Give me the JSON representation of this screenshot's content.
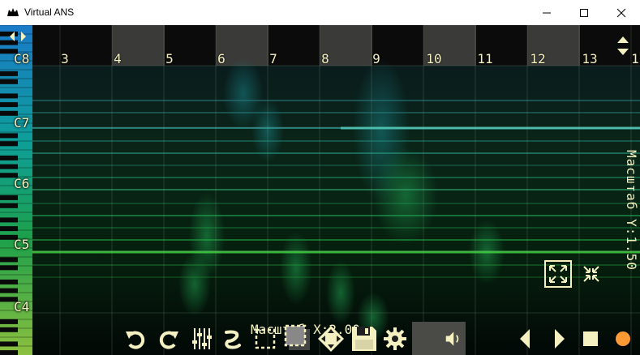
{
  "window": {
    "title": "Virtual ANS",
    "controls": [
      "minimize",
      "maximize",
      "close"
    ]
  },
  "timeline": {
    "labels": [
      "3",
      "4",
      "5",
      "6",
      "7",
      "8",
      "9",
      "10",
      "11",
      "12",
      "13",
      "1"
    ]
  },
  "notes": {
    "labels": [
      "C8",
      "C7",
      "C6",
      "C5",
      "C4"
    ]
  },
  "scale": {
    "y_label": "Масштаб Y:1.50",
    "x_label": "Масштаб X:2.00"
  },
  "toolbar": {
    "tools": [
      "undo",
      "redo",
      "equalizer",
      "brush",
      "select",
      "select-shadow",
      "move",
      "save",
      "settings",
      "volume",
      "play-back",
      "play-forward",
      "stop",
      "record"
    ]
  },
  "colors": {
    "accent_text": "#f4f0c0",
    "spectrogram": "#00b060",
    "record": "#ff9933"
  }
}
